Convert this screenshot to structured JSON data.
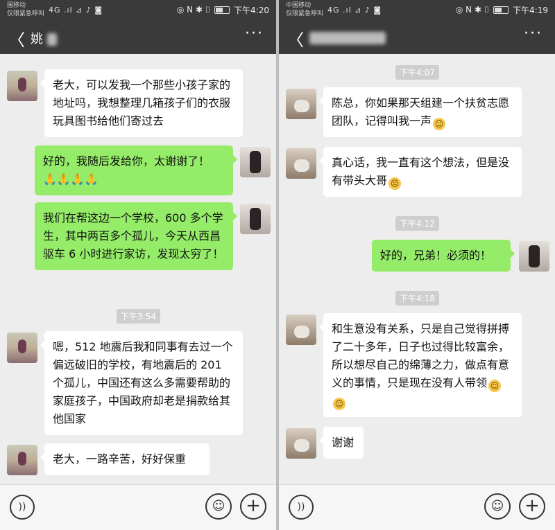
{
  "left": {
    "status": {
      "carrier_line1": "国移动",
      "carrier_line2": "仅限紧急呼叫",
      "signal": "4G .ıl ⊿ ♪ ◙",
      "icons": "◎ N ✱ ⌷",
      "time": "下午4:20"
    },
    "nav": {
      "back": "〈",
      "title": "姚",
      "more": "···"
    },
    "times": [
      "下午3:54"
    ],
    "messages": [
      {
        "text": "老大，可以发我一个那些小孩子家的地址吗，我想整理几箱孩子们的衣服玩具图书给他们寄过去"
      },
      {
        "text": "好的，我随后发给你，太谢谢了！",
        "extra": "🙏🙏🙏🙏"
      },
      {
        "text": "我们在帮这边一个学校，600 多个学生，其中两百多个孤儿，今天从西昌驱车 6 小时进行家访，发现太穷了！"
      },
      {
        "text": "嗯，512 地震后我和同事有去过一个偏远破旧的学校，有地震后的 201 个孤儿，中国还有这么多需要帮助的家庭孩子，中国政府却老是捐款给其他国家"
      },
      {
        "text": "老大，一路辛苦，好好保重"
      }
    ]
  },
  "right": {
    "status": {
      "carrier_line1": "中国移动",
      "carrier_line2": "仅限紧急呼叫",
      "signal": "4G .ıl ⊿ ♪ ◙",
      "icons": "◎ N ✱ ⌷",
      "time": "下午4:19"
    },
    "nav": {
      "back": "〈",
      "more": "···"
    },
    "times": [
      "下午4:07",
      "下午4:12",
      "下午4:18"
    ],
    "messages": [
      {
        "text": "陈总，你如果那天组建一个扶贫志愿团队，记得叫我一声",
        "emoji": "🙂"
      },
      {
        "text": "真心话，我一直有这个想法，但是没有带头大哥",
        "emoji": "🙁"
      },
      {
        "text": "好的，兄弟！必须的！"
      },
      {
        "text": "和生意没有关系，只是自己觉得拼搏了二十多年，日子也过得比较富余，所以想尽自己的绵薄之力，做点有意义的事情，只是现在没有人带领",
        "emoji": "🙂🙂"
      },
      {
        "text": "谢谢"
      }
    ]
  },
  "bottom": {
    "voice_icon": "voice-icon",
    "emoji_icon": "emoji-icon",
    "plus_icon": "plus-icon"
  }
}
